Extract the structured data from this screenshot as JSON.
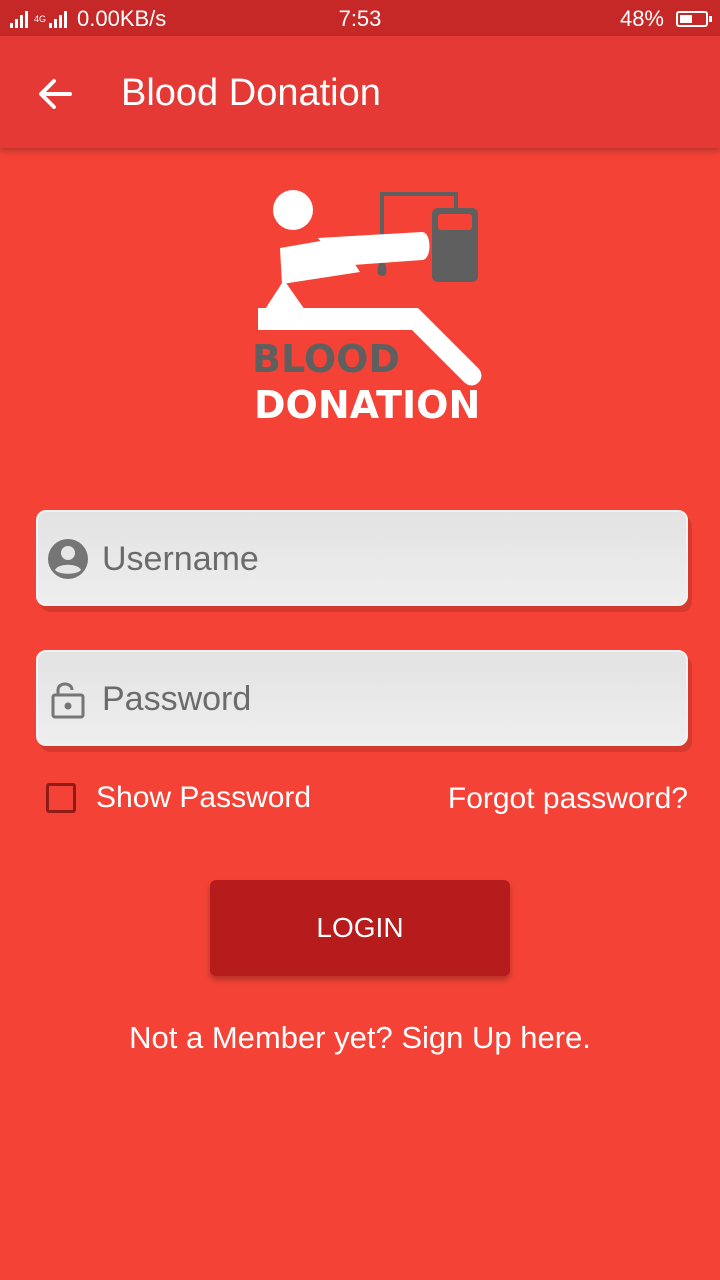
{
  "status_bar": {
    "network": "4G",
    "speed": "0.00KB/s",
    "time": "7:53",
    "battery": "48%",
    "battery_level": 0.48
  },
  "app_bar": {
    "title": "Blood Donation",
    "back_icon": "arrow-left-icon"
  },
  "logo": {
    "word1": "BLOOD",
    "word2": "DONATION",
    "icon": "blood-donation-logo"
  },
  "form": {
    "username_placeholder": "Username",
    "password_placeholder": "Password",
    "username_icon": "account-circle-icon",
    "password_icon": "lock-open-icon",
    "show_password_label": "Show Password",
    "show_password_checked": false,
    "forgot_password": "Forgot password?",
    "login_label": "LOGIN",
    "signup_text": "Not a Member yet? Sign Up here."
  },
  "colors": {
    "background": "#f44336",
    "app_bar": "#e53935",
    "status_bar": "#c62828",
    "login_button": "#b71c1c",
    "field": "#e8e8e8",
    "logo_gray": "#5f5f5f"
  }
}
